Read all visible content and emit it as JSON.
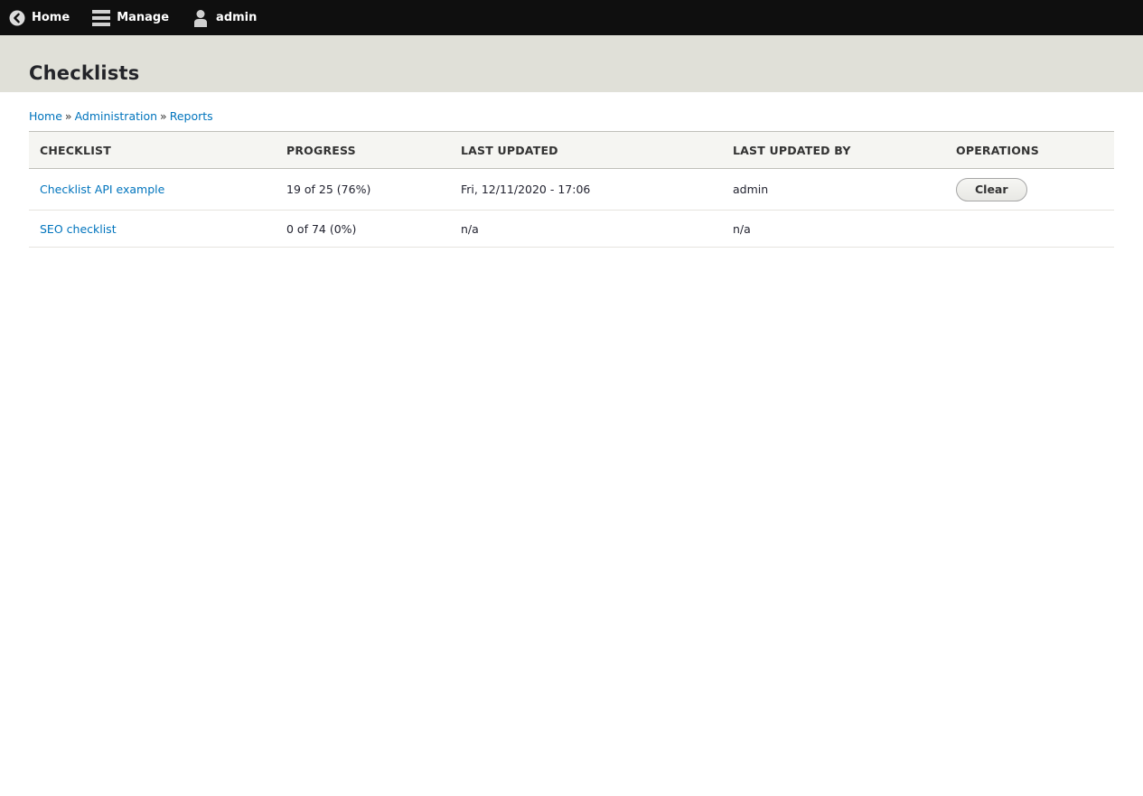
{
  "toolbar": {
    "home_label": "Home",
    "manage_label": "Manage",
    "user_label": "admin"
  },
  "page": {
    "title": "Checklists"
  },
  "breadcrumb": {
    "items": [
      "Home",
      "Administration",
      "Reports"
    ],
    "separator": "»"
  },
  "table": {
    "headers": [
      "Checklist",
      "Progress",
      "Last updated",
      "Last updated by",
      "Operations"
    ],
    "rows": [
      {
        "checklist": "Checklist API example",
        "progress": "19 of 25 (76%)",
        "last_updated": "Fri, 12/11/2020 - 17:06",
        "last_updated_by": "admin",
        "operation": "Clear"
      },
      {
        "checklist": "SEO checklist",
        "progress": "0 of 74 (0%)",
        "last_updated": "n/a",
        "last_updated_by": "n/a",
        "operation": ""
      }
    ]
  },
  "colors": {
    "toolbar_bg": "#0f0f0f",
    "header_bg": "#e0e0d8",
    "link": "#0074bd"
  }
}
